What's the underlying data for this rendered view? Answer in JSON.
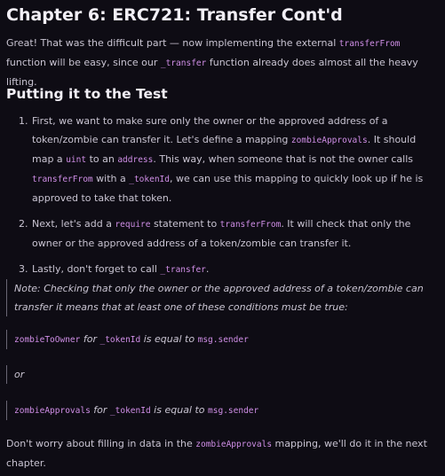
{
  "title": "Chapter 6: ERC721: Transfer Cont'd",
  "intro": {
    "t1": "Great! That was the difficult part — now implementing the external ",
    "c1": "transferFrom",
    "t2": " function will be easy, since our ",
    "c2": "_transfer",
    "t3": " function already does almost all the heavy lifting."
  },
  "section_title": "Putting it to the Test",
  "steps": [
    {
      "t1": "First, we want to make sure only the owner or the approved address of a token/zombie can transfer it. Let's define a mapping ",
      "c1": "zombieApprovals",
      "t2": ". It should map a ",
      "c2": "uint",
      "t3": " to an ",
      "c3": "address",
      "t4": ". This way, when someone that is not the owner calls ",
      "c4": "transferFrom",
      "t5": " with a ",
      "c5": "_tokenId",
      "t6": ", we can use this mapping to quickly look up if he is approved to take that token."
    },
    {
      "t1": "Next, let's add a ",
      "c1": "require",
      "t2": " statement to ",
      "c2": "transferFrom",
      "t3": ". It will check that only the owner or the approved address of a token/zombie can transfer it."
    },
    {
      "t1": "Lastly, don't forget to call ",
      "c1": "_transfer",
      "t2": "."
    }
  ],
  "note": {
    "text": "Note: Checking that only the owner or the approved address of a token/zombie can transfer it means that at least one of these conditions must be true:",
    "cond1": {
      "c1": "zombieToOwner",
      "t1": " for ",
      "c2": "_tokenId",
      "t2": " is equal to ",
      "c3": "msg.sender"
    },
    "or": "or",
    "cond2": {
      "c1": "zombieApprovals",
      "t1": " for ",
      "c2": "_tokenId",
      "t2": " is equal to ",
      "c3": "msg.sender"
    }
  },
  "outro": {
    "t1": "Don't worry about filling in data in the ",
    "c1": "zombieApprovals",
    "t2": " mapping, we'll do it in the next chapter."
  },
  "colors": {
    "background": "#0e0c14",
    "code": "#cf8ee6",
    "heading": "#f2eff6",
    "text": "#c9c4d2"
  }
}
